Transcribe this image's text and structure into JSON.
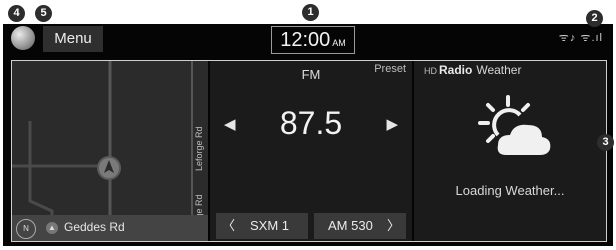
{
  "header": {
    "menu_label": "Menu",
    "time": "12:00",
    "ampm": "AM",
    "status_icons": "ᯤ♪ ᯤ.ıl"
  },
  "map": {
    "road_label_1": "Leforge Rd",
    "road_label_2": "Leforge Rd",
    "compass_label": "N",
    "street_name": "Geddes Rd"
  },
  "radio": {
    "band": "FM",
    "preset_label": "Preset",
    "frequency": "87.5",
    "prev_arrow": "◀",
    "next_arrow": "▶",
    "seek_prev_station": "SXM 1",
    "seek_next_station": "AM 530",
    "chevron_left": "〈",
    "chevron_right": "〉"
  },
  "weather": {
    "hd_logo": "HD",
    "radio_label": "Radio",
    "title": "Weather",
    "loading_text": "Loading Weather..."
  },
  "callouts": [
    "1",
    "2",
    "3",
    "4",
    "5"
  ],
  "colors": {
    "screen_bg": "#050505",
    "panel_bg": "#1b1b1b",
    "button_bg": "#3a3a3a",
    "border": "#cfcfcf"
  }
}
